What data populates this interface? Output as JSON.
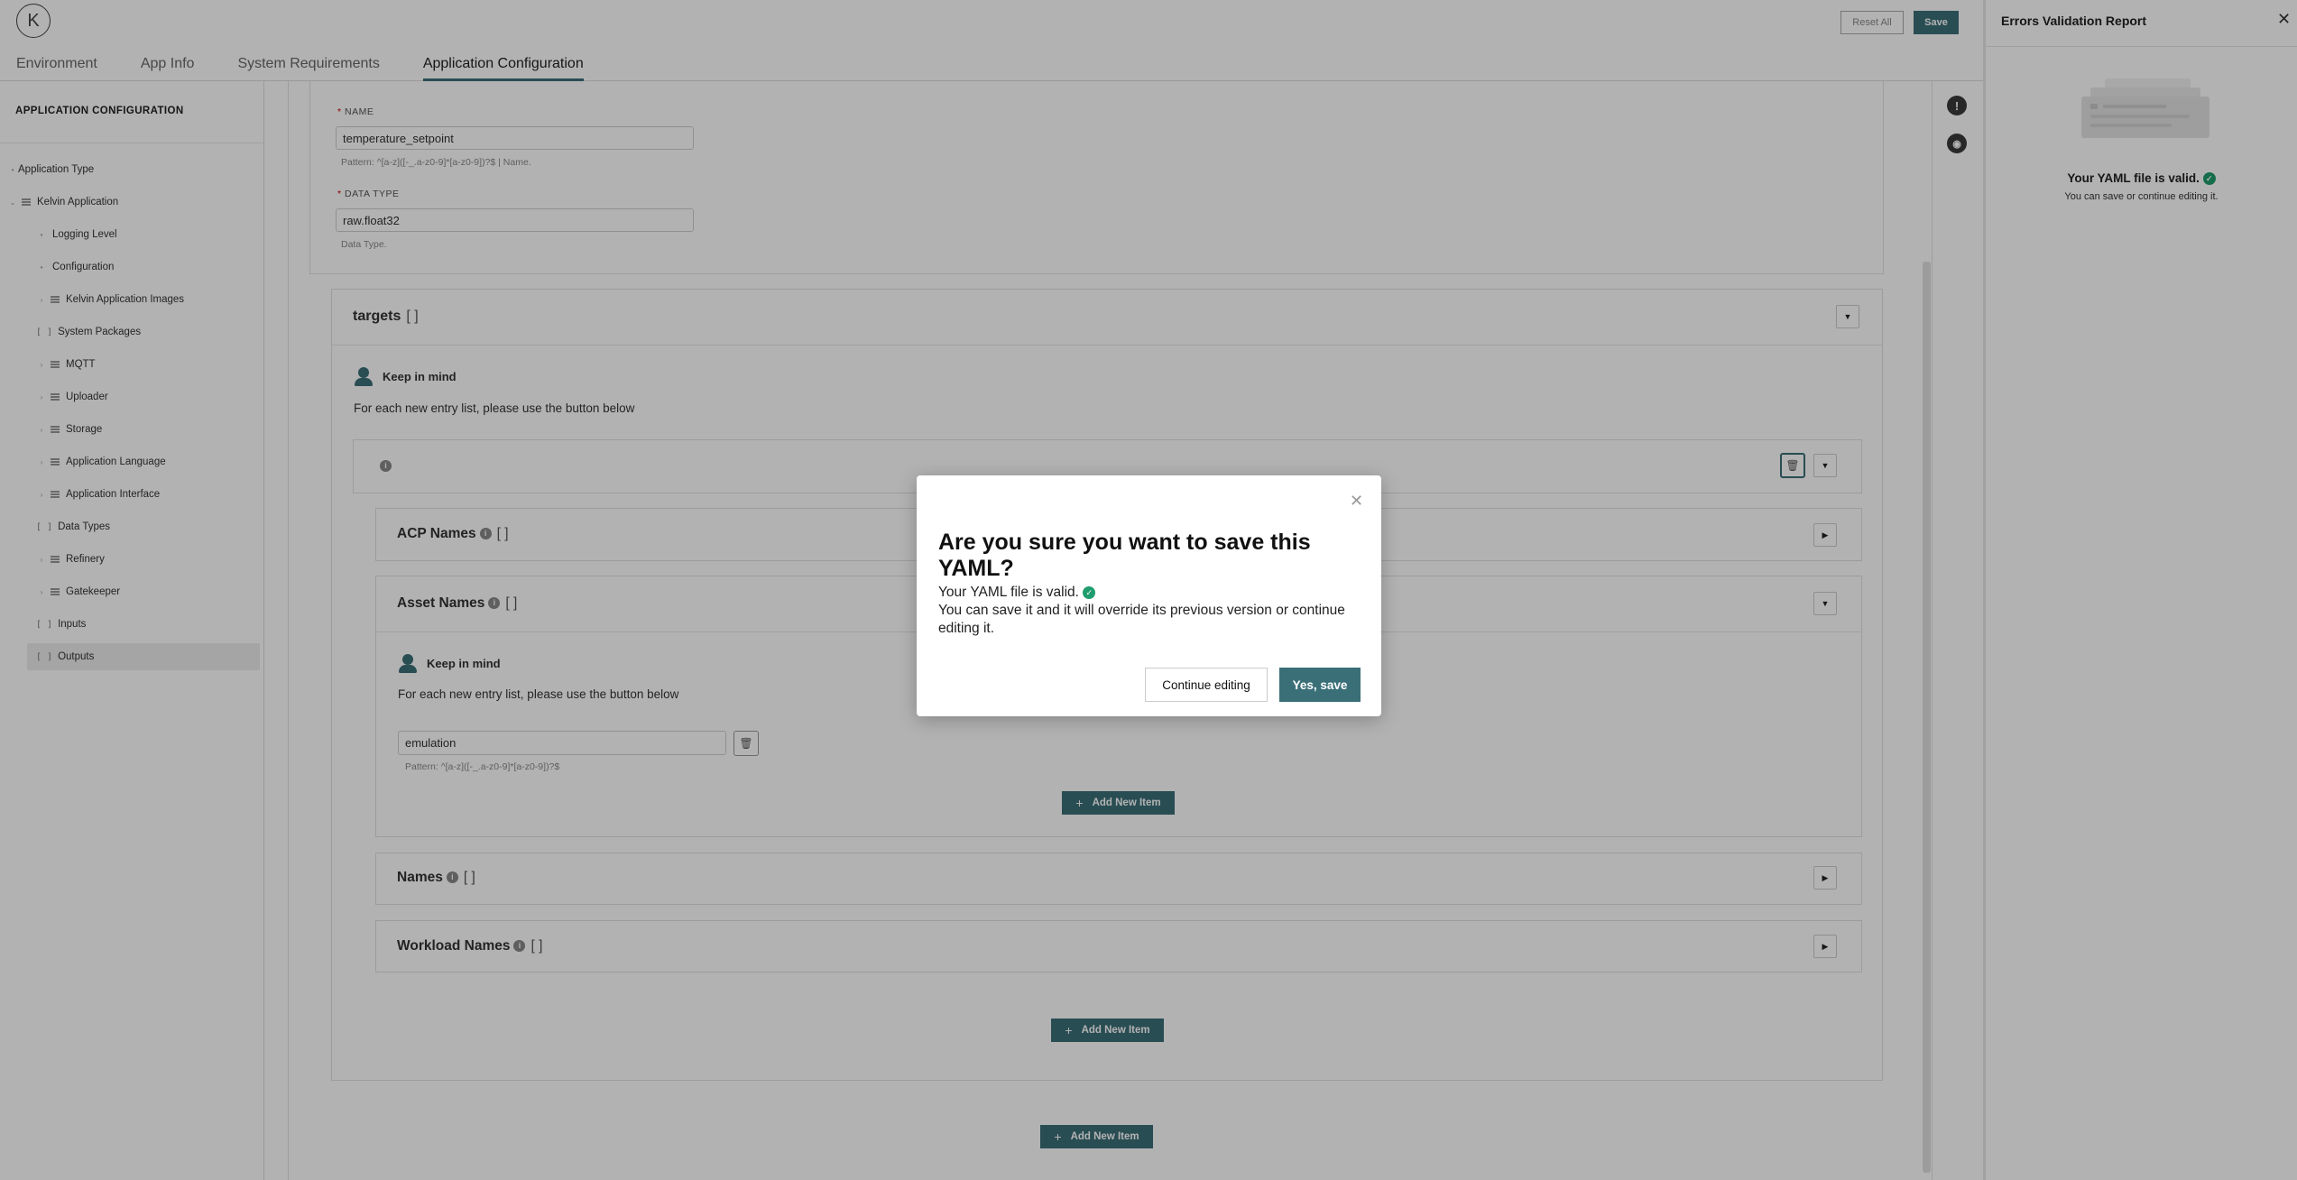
{
  "app": {
    "logo_letter": "K"
  },
  "header": {
    "tabs": [
      {
        "label": "Environment"
      },
      {
        "label": "App Info"
      },
      {
        "label": "System Requirements"
      },
      {
        "label": "Application Configuration"
      }
    ],
    "reset_label": "Reset All",
    "save_label": "Save"
  },
  "sidebar": {
    "title": "APPLICATION CONFIGURATION",
    "items": [
      {
        "label": "Application Type",
        "kind": "field"
      },
      {
        "label": "Kelvin Application",
        "kind": "object"
      },
      {
        "label": "Logging Level",
        "kind": "field"
      },
      {
        "label": "Configuration",
        "kind": "field"
      },
      {
        "label": "Kelvin Application Images",
        "kind": "object"
      },
      {
        "label": "System Packages",
        "kind": "array"
      },
      {
        "label": "MQTT",
        "kind": "object"
      },
      {
        "label": "Uploader",
        "kind": "object"
      },
      {
        "label": "Storage",
        "kind": "object"
      },
      {
        "label": "Application Language",
        "kind": "object"
      },
      {
        "label": "Application Interface",
        "kind": "object"
      },
      {
        "label": "Data Types",
        "kind": "array"
      },
      {
        "label": "Refinery",
        "kind": "object"
      },
      {
        "label": "Gatekeeper",
        "kind": "object"
      },
      {
        "label": "Inputs",
        "kind": "array"
      },
      {
        "label": "Outputs",
        "kind": "array",
        "selected": true
      }
    ]
  },
  "form": {
    "name": {
      "label": "NAME",
      "value": "temperature_setpoint",
      "hint": "Pattern: ^[a-z]([-_.a-z0-9]*[a-z0-9])?$ | Name."
    },
    "data_type": {
      "label": "DATA TYPE",
      "value": "raw.float32",
      "hint": "Data Type."
    },
    "targets": {
      "title": "targets",
      "brackets": "[ ]",
      "keep_in_mind": "Keep in mind",
      "keep_text": "For each new entry list, please use the button below",
      "item": {
        "acp_names": {
          "title": "ACP Names",
          "brackets": "[ ]"
        },
        "asset_names": {
          "title": "Asset Names",
          "brackets": "[ ]",
          "keep_in_mind": "Keep in mind",
          "keep_text": "For each new entry list, please use the button below",
          "value": "emulation",
          "hint": "Pattern: ^[a-z]([-_.a-z0-9]*[a-z0-9])?$",
          "add_label": "Add New Item"
        },
        "names": {
          "title": "Names",
          "brackets": "[ ]"
        },
        "workload_names": {
          "title": "Workload Names",
          "brackets": "[ ]"
        }
      },
      "add_label": "Add New Item"
    },
    "outer_add_label": "Add New Item"
  },
  "right_panel": {
    "title": "Errors Validation Report",
    "valid_text": "Your YAML file is valid.",
    "sub_text": "You can save or continue editing it."
  },
  "modal": {
    "title": "Are you sure you want to save this YAML?",
    "valid_text": "Your YAML file is valid.",
    "body": "You can save it and it will override its previous version or continue editing it.",
    "continue_label": "Continue editing",
    "yes_label": "Yes, save"
  },
  "colors": {
    "accent": "#3a6f78",
    "valid": "#1f9d6e"
  }
}
